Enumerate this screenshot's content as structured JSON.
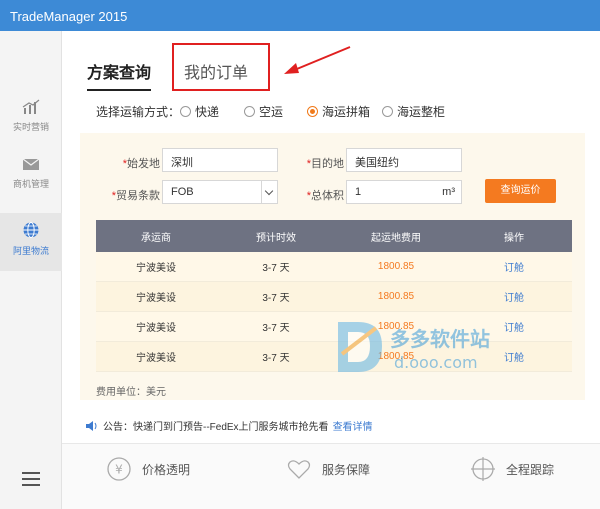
{
  "window": {
    "title": "TradeManager 2015"
  },
  "sidebar": {
    "items": [
      {
        "label": "实时营销",
        "icon": "chart-icon"
      },
      {
        "label": "商机管理",
        "icon": "mail-icon"
      },
      {
        "label": "阿里物流",
        "icon": "globe-icon"
      }
    ],
    "menu_icon": "menu-icon"
  },
  "tabs": {
    "active": "方案查询",
    "inactive": "我的订单"
  },
  "shipping": {
    "label": "选择运输方式：",
    "options": [
      "快递",
      "空运",
      "海运拼箱",
      "海运整柜"
    ],
    "selected": "海运拼箱"
  },
  "form": {
    "origin_label": "始发地",
    "origin_value": "深圳",
    "destination_label": "目的地",
    "destination_value": "美国纽约",
    "trade_terms_label": "贸易条款",
    "trade_terms_value": "FOB",
    "volume_label": "总体积",
    "volume_value": "1",
    "volume_unit": "m³",
    "query_button": "查询运价"
  },
  "table": {
    "headers": [
      "承运商",
      "预计时效",
      "起运地费用",
      "操作"
    ],
    "rows": [
      {
        "carrier": "宁波美设",
        "time": "3-7 天",
        "price": "1800.85",
        "action": "订舱"
      },
      {
        "carrier": "宁波美设",
        "time": "3-7 天",
        "price": "1800.85",
        "action": "订舱"
      },
      {
        "carrier": "宁波美设",
        "time": "3-7 天",
        "price": "1800.85",
        "action": "订舱"
      },
      {
        "carrier": "宁波美设",
        "time": "3-7 天",
        "price": "1800.85",
        "action": "订舱"
      }
    ],
    "fee_unit": "费用单位：美元"
  },
  "notice": {
    "text": "公告：快递门到门预告--FedEx上门服务城市抢先看",
    "link": "查看详情"
  },
  "features": [
    {
      "label": "价格透明",
      "icon": "yen-icon"
    },
    {
      "label": "服务保障",
      "icon": "heart-icon"
    },
    {
      "label": "全程跟踪",
      "icon": "target-icon"
    }
  ],
  "watermark": {
    "brand": "多多软件站",
    "url": "d.ooo.com"
  },
  "colors": {
    "titlebar": "#3d8ad6",
    "accent": "#f47a20",
    "link": "#3d7bd0",
    "annotation": "#e02020"
  }
}
